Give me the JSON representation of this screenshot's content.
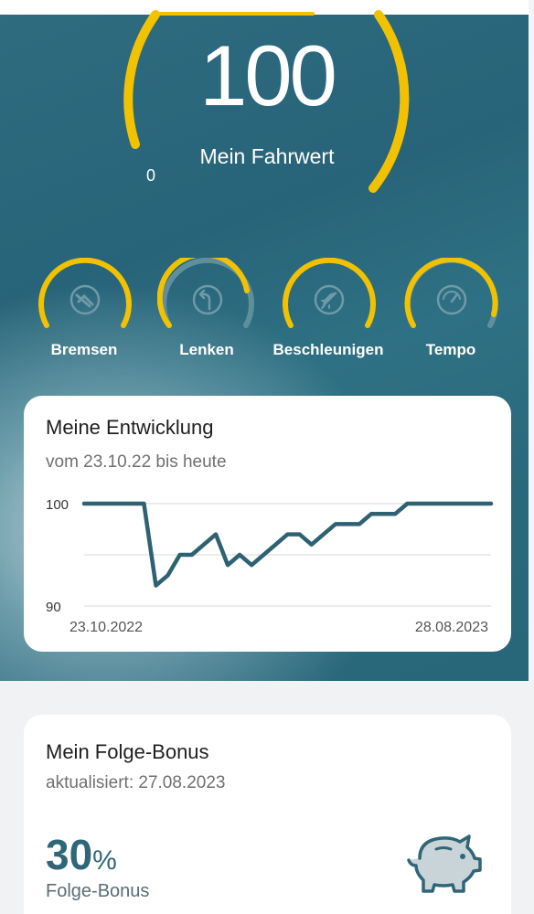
{
  "score": {
    "value": "100",
    "label": "Mein Fahrwert",
    "min_label": "0",
    "level": 1.0
  },
  "categories": [
    {
      "label": "Bremsen",
      "icon": "brake-icon",
      "level": 1.0
    },
    {
      "label": "Lenken",
      "icon": "steering-turn-icon",
      "level": 0.78
    },
    {
      "label": "Beschleunigen",
      "icon": "rocket-icon",
      "level": 1.0
    },
    {
      "label": "Tempo",
      "icon": "speedometer-icon",
      "level": 0.93
    }
  ],
  "development": {
    "title": "Meine Entwicklung",
    "subtitle": "vom 23.10.22 bis heute"
  },
  "chart_data": {
    "type": "line",
    "x_start_label": "23.10.2022",
    "x_end_label": "28.08.2023",
    "y_tick_labels": [
      "100",
      "90"
    ],
    "ylim": [
      90,
      100
    ],
    "grid": true,
    "series": [
      {
        "values": [
          100,
          100,
          100,
          100,
          100,
          100,
          92,
          93,
          95,
          95,
          96,
          97,
          94,
          95,
          94,
          95,
          96,
          97,
          97,
          96,
          97,
          98,
          98,
          98,
          99,
          99,
          99,
          100,
          100,
          100,
          100,
          100,
          100,
          100,
          100
        ]
      }
    ],
    "colors": {
      "line": "#2e6272",
      "grid": "#e6e6e6"
    }
  },
  "bonus": {
    "title": "Mein Folge-Bonus",
    "updated": "aktualisiert: 27.08.2023",
    "value": "30",
    "unit": "%",
    "label": "Folge-Bonus",
    "icon": "piggy-bank-icon"
  },
  "colors": {
    "accent": "#f2c200",
    "teal": "#2a677b",
    "track": "#5b8c9a"
  }
}
